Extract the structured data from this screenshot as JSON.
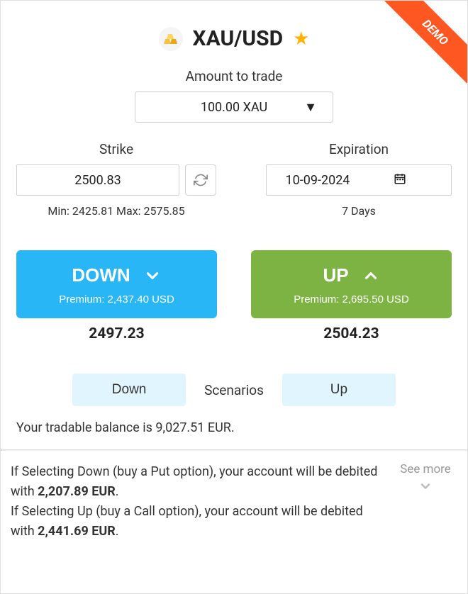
{
  "ribbon": {
    "label": "DEMO"
  },
  "header": {
    "pair": "XAU/USD"
  },
  "amount": {
    "label": "Amount to trade",
    "value": "100.00 XAU"
  },
  "strike": {
    "label": "Strike",
    "value": "2500.83",
    "range": "Min: 2425.81 Max: 2575.85"
  },
  "expiration": {
    "label": "Expiration",
    "value": "10-09-2024",
    "duration": "7 Days"
  },
  "down": {
    "label": "DOWN",
    "premium": "Premium: 2,437.40 USD",
    "bep": "2497.23"
  },
  "up": {
    "label": "UP",
    "premium": "Premium: 2,695.50 USD",
    "bep": "2504.23"
  },
  "scenarios": {
    "down": "Down",
    "label": "Scenarios",
    "up": "Up"
  },
  "balance": "Your tradable balance is 9,027.51 EUR.",
  "info": {
    "down_prefix": "If Selecting Down (buy a Put option), your account will be debited with ",
    "down_amount": "2,207.89 EUR",
    "up_prefix": "If Selecting Up (buy a Call option), your account will be debited with ",
    "up_amount": "2,441.69 EUR",
    "period": "."
  },
  "see_more": "See more"
}
